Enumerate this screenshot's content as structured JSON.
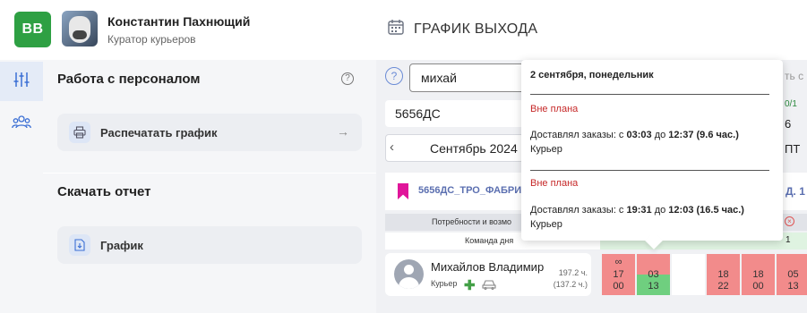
{
  "header": {
    "logo_text": "BB",
    "user_name": "Константин Пахнющий",
    "user_role": "Куратор курьеров",
    "page_title": "ГРАФИК ВЫХОДА"
  },
  "panel": {
    "section1_title": "Работа с персоналом",
    "print_label": "Распечатать график",
    "section2_title": "Скачать отчет",
    "download_label": "График"
  },
  "filters": {
    "search_value": "михай",
    "store": "5656ДС",
    "month": "Сентябрь 2024"
  },
  "right_edge": {
    "hint": "ть с",
    "frac": "0/1",
    "day_num": "6",
    "weekday": "ПТ"
  },
  "group": {
    "name": "5656ДС_ТРО_ФАБРИ",
    "right": "Д. 1"
  },
  "rows": {
    "needs": "Потребности и возмо",
    "team": "Команда дня",
    "team_value": "1"
  },
  "person": {
    "name": "Михайлов Владимир",
    "role": "Курьер",
    "hours_total": "197.2 ч.",
    "hours_alt": "(137.2 ч.)"
  },
  "cells": [
    {
      "top": "∞",
      "a": "17",
      "b": "00",
      "bg": "#f28b8b"
    },
    {
      "top": "",
      "a": "03",
      "b": "13",
      "bg": "split"
    },
    {
      "top": "",
      "a": "",
      "b": "",
      "bg": "#ffffff"
    },
    {
      "top": "",
      "a": "18",
      "b": "22",
      "bg": "#f28b8b"
    },
    {
      "top": "",
      "a": "18",
      "b": "00",
      "bg": "#f28b8b"
    },
    {
      "top": "",
      "a": "05",
      "b": "13",
      "bg": "#f28b8b"
    }
  ],
  "tooltip": {
    "date": "2 сентября, понедельник",
    "entries": [
      {
        "status": "Вне плана",
        "prefix": "Доставлял заказы: с ",
        "from": "03:03",
        "mid": " до ",
        "to": "12:37",
        "dur": "(9.6 час.)",
        "role": "Курьер"
      },
      {
        "status": "Вне плана",
        "prefix": "Доставлял заказы: с ",
        "from": "19:31",
        "mid": " до ",
        "to": "12:03",
        "dur": "(16.5 час.)",
        "role": "Курьер"
      }
    ]
  },
  "colors": {
    "brand": "#2ea043",
    "accent": "#5b6fb0",
    "off_plan": "#c62828",
    "shift_red": "#f28b8b",
    "shift_green": "#6fcf7f"
  },
  "icons": {
    "rail_top": "sliders-icon",
    "rail_bottom": "users-icon",
    "print": "printer-icon",
    "download": "file-download-icon",
    "calendar": "calendar-icon"
  }
}
